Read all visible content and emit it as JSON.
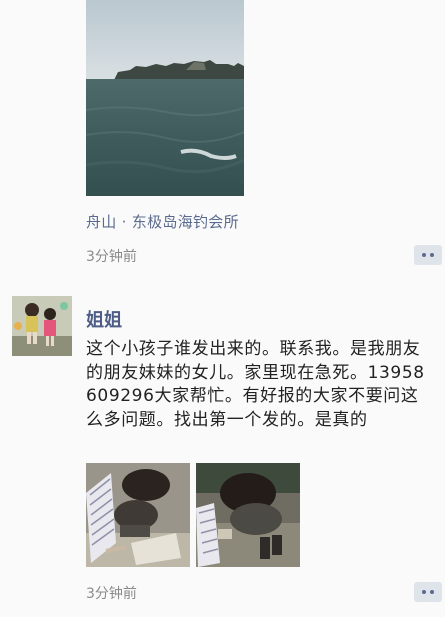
{
  "post1": {
    "location": "舟山 · 东极岛海钓会所",
    "time": "3分钟前",
    "image_subject": "sea with rocky islands"
  },
  "post2": {
    "username": "姐姐",
    "text": "这个小孩子谁发出来的。联系我。是我朋友的朋友妹妹的女儿。家里现在急死。13958609296大家帮忙。有好报的大家不要问这么多问题。找出第一个发的。是真的",
    "time": "3分钟前",
    "images": [
      "child sitting on pavement with sign",
      "child sitting on pavement with sign"
    ]
  },
  "colors": {
    "name_blue": "#4d5d86",
    "location_blue": "#5b6b8f",
    "time_gray": "#8a8a8a",
    "background": "#fafafa"
  },
  "icons": {
    "comment": "comment-icon"
  }
}
